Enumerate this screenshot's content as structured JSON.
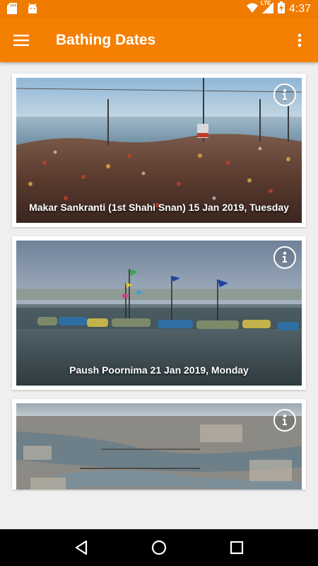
{
  "status_bar": {
    "time": "4:37",
    "network": "LTE",
    "icons": [
      "sd-card-icon",
      "android-icon",
      "wifi-icon",
      "signal-icon",
      "battery-charging-icon"
    ]
  },
  "app_bar": {
    "title": "Bathing Dates",
    "menu_icon": "hamburger-menu-icon",
    "overflow_icon": "more-vertical-icon"
  },
  "cards": [
    {
      "caption": "Makar Sankranti (1st Shahi Snan)  15 Jan 2019, Tuesday",
      "image": "crowd-at-river-photo",
      "info_icon": "info-icon"
    },
    {
      "caption": "Paush Poornima 21 Jan 2019, Monday",
      "image": "boats-on-river-photo",
      "info_icon": "info-icon"
    },
    {
      "caption": "",
      "image": "aerial-city-river-photo",
      "info_icon": "info-icon"
    }
  ],
  "nav_bar": {
    "back": "back-icon",
    "home": "home-icon",
    "recents": "recents-icon"
  },
  "colors": {
    "primary": "#f57f00",
    "status_bar": "#ef7b00",
    "background": "#efefef"
  }
}
